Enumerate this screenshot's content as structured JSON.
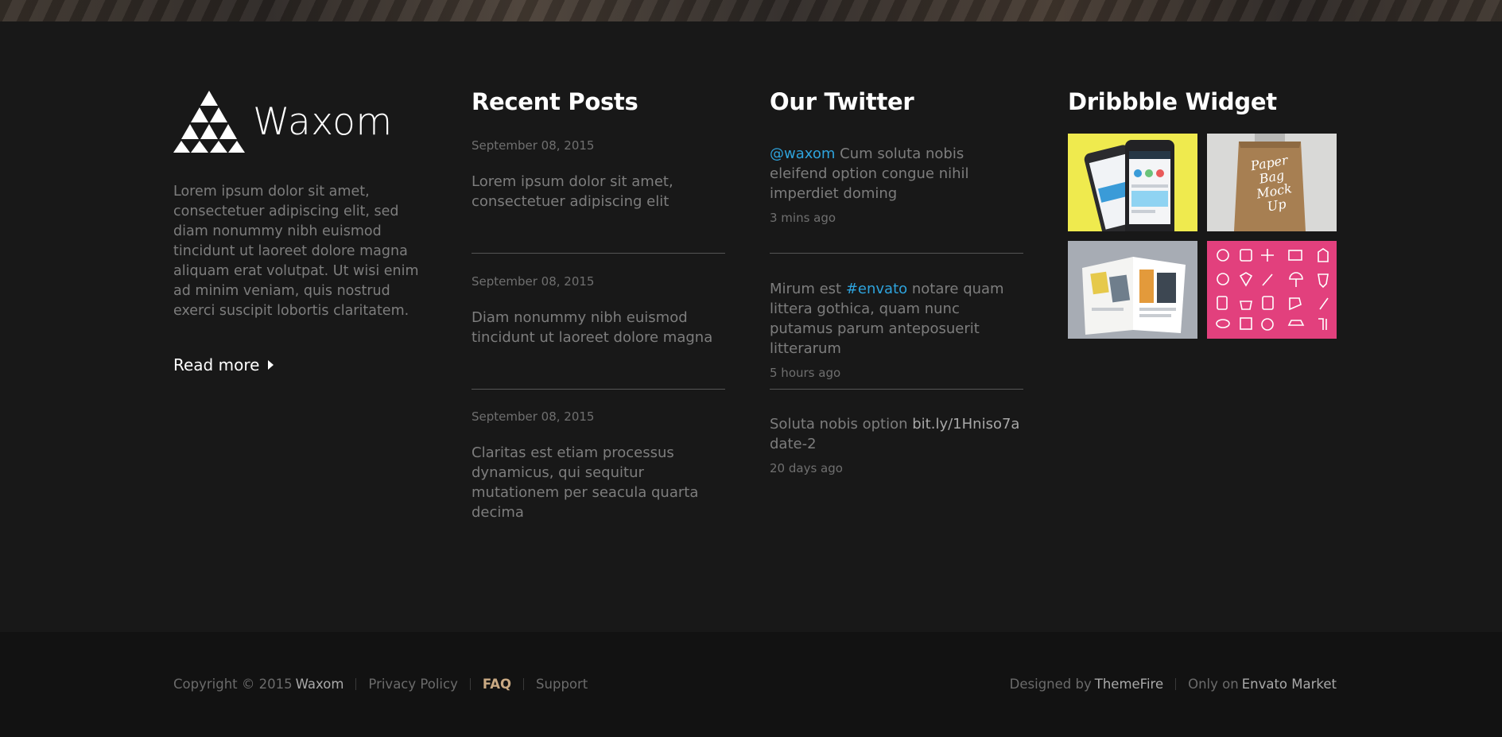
{
  "brand": {
    "name": "Waxom"
  },
  "about": {
    "text": "Lorem ipsum dolor sit amet, consectetuer adipiscing elit, sed diam nonummy nibh euismod tincidunt ut laoreet dolore magna aliquam erat volutpat. Ut wisi enim ad minim veniam, quis nostrud exerci suscipit lobortis claritatem.",
    "read_more": "Read more"
  },
  "recent_posts": {
    "title": "Recent Posts",
    "items": [
      {
        "date": "September 08, 2015",
        "text": "Lorem ipsum dolor sit amet, consectetuer adipiscing elit"
      },
      {
        "date": "September 08, 2015",
        "text": "Diam nonummy nibh euismod tincidunt ut laoreet dolore magna"
      },
      {
        "date": "September 08, 2015",
        "text": "Claritas est etiam processus dynamicus, qui sequitur mutationem per seacula quarta decima"
      }
    ]
  },
  "twitter": {
    "title": "Our Twitter",
    "items": [
      {
        "link": "@waxom",
        "text": " Cum soluta nobis eleifend option congue nihil imperdiet doming",
        "time": "3 mins ago"
      },
      {
        "pre": "Mirum est ",
        "link": "#envato",
        "text": " notare quam littera gothica, quam nunc putamus parum anteposuerit litterarum",
        "time": "5 hours ago"
      },
      {
        "pre": "Soluta nobis option ",
        "url": "bit.ly/1Hniso7a",
        "text": "date-2",
        "time": "20 days ago"
      }
    ]
  },
  "dribbble": {
    "title": "Dribbble Widget",
    "shot_labels": [
      "Paper Bag Mock Up"
    ]
  },
  "bottom_bar": {
    "copyright_prefix": "Copyright © 2015",
    "copyright_brand": "Waxom",
    "links": [
      "Privacy Policy",
      "FAQ",
      "Support"
    ],
    "designed_by_label": "Designed by",
    "designed_by": "ThemeFire",
    "only_on_label": "Only on",
    "only_on": "Envato Market"
  },
  "colors": {
    "background": "#181818",
    "bottom_bar": "#121212",
    "twitter_link": "#2ea3dc",
    "faq_active": "#c9a983",
    "pink_shot": "#e2407d",
    "yellow_shot": "#efea4e"
  }
}
